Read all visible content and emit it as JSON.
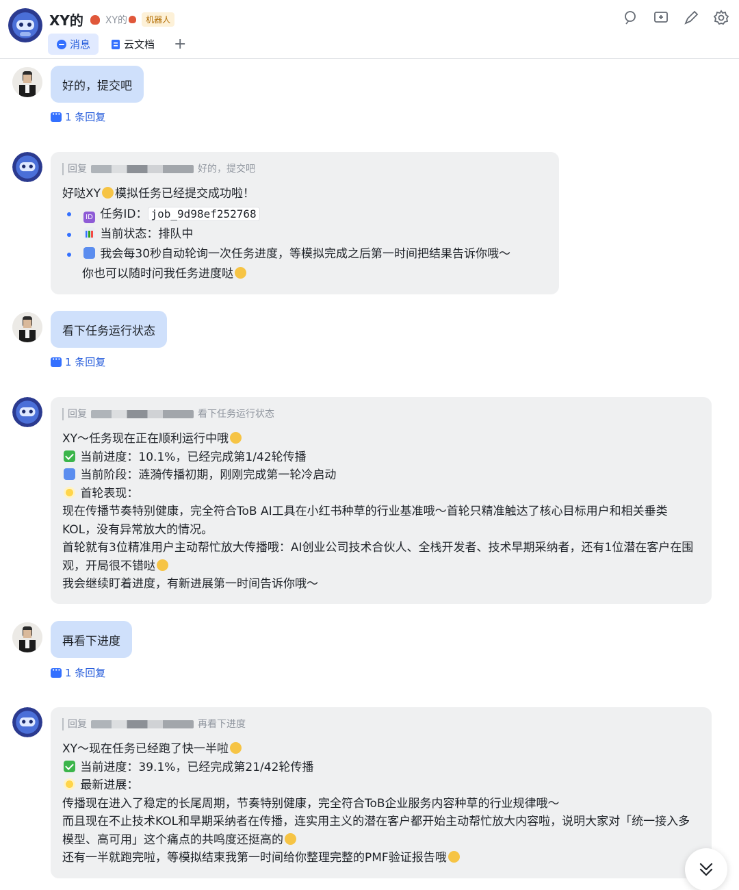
{
  "header": {
    "title": "XY的",
    "subtitle": "XY的",
    "tag": "机器人",
    "tabs": [
      {
        "label": "消息",
        "active": true,
        "icon": "chat-bubble-icon"
      },
      {
        "label": "云文档",
        "active": false,
        "icon": "doc-icon"
      }
    ],
    "add_tab": "+",
    "actions": [
      "search-icon",
      "add-chat-icon",
      "edit-icon",
      "settings-icon"
    ]
  },
  "colors": {
    "accent": "#245bdb",
    "user_bubble": "#cfe0fb",
    "bot_bubble": "#eff0f1"
  },
  "messages": [
    {
      "sender": "user",
      "text": "好的，提交吧",
      "reply_count": "1 条回复"
    },
    {
      "sender": "bot",
      "reply_prefix": "回复",
      "reply_quote": "好的，提交吧",
      "line1": "好哒XY",
      "line1b": "模拟任务已经提交成功啦！",
      "bullets": [
        {
          "label": "任务ID：",
          "code": "job_9d98ef252768"
        },
        {
          "text": "当前状态：排队中"
        },
        {
          "text": "我会每30秒自动轮询一次任务进度，等模拟完成之后第一时间把结果告诉你哦～",
          "text2": "你也可以随时问我任务进度哒"
        }
      ]
    },
    {
      "sender": "user",
      "text": "看下任务运行状态",
      "reply_count": "1 条回复"
    },
    {
      "sender": "bot",
      "reply_prefix": "回复",
      "reply_quote": "看下任务运行状态",
      "lines": [
        "XY～任务现在正在顺利运行中哦",
        "当前进度：10.1%，已经完成第1/42轮传播",
        "当前阶段：涟漪传播初期，刚刚完成第一轮冷启动",
        "首轮表现：",
        "现在传播节奏特别健康，完全符合ToB AI工具在小红书种草的行业基准哦～首轮只精准触达了核心目标用户和相关垂类KOL，没有异常放大的情况。",
        "首轮就有3位精准用户主动帮忙放大传播哦：AI创业公司技术合伙人、全栈开发者、技术早期采纳者，还有1位潜在客户在围观，开局很不错哒",
        "我会继续盯着进度，有新进展第一时间告诉你哦～"
      ]
    },
    {
      "sender": "user",
      "text": "再看下进度",
      "reply_count": "1 条回复"
    },
    {
      "sender": "bot",
      "reply_prefix": "回复",
      "reply_quote": "再看下进度",
      "lines": [
        "XY～现在任务已经跑了快一半啦",
        "当前进度：39.1%，已经完成第21/42轮传播",
        "最新进展：",
        "传播现在进入了稳定的长尾周期，节奏特别健康，完全符合ToB企业服务内容种草的行业规律哦～",
        "而且现在不止技术KOL和早期采纳者在传播，连实用主义的潜在客户都开始主动帮忙放大内容啦，说明大家对「统一接入多模型、高可用」这个痛点的共鸣度还挺高的",
        "还有一半就跑完啦，等模拟结束我第一时间给你整理完整的PMF验证报告哦"
      ]
    }
  ]
}
